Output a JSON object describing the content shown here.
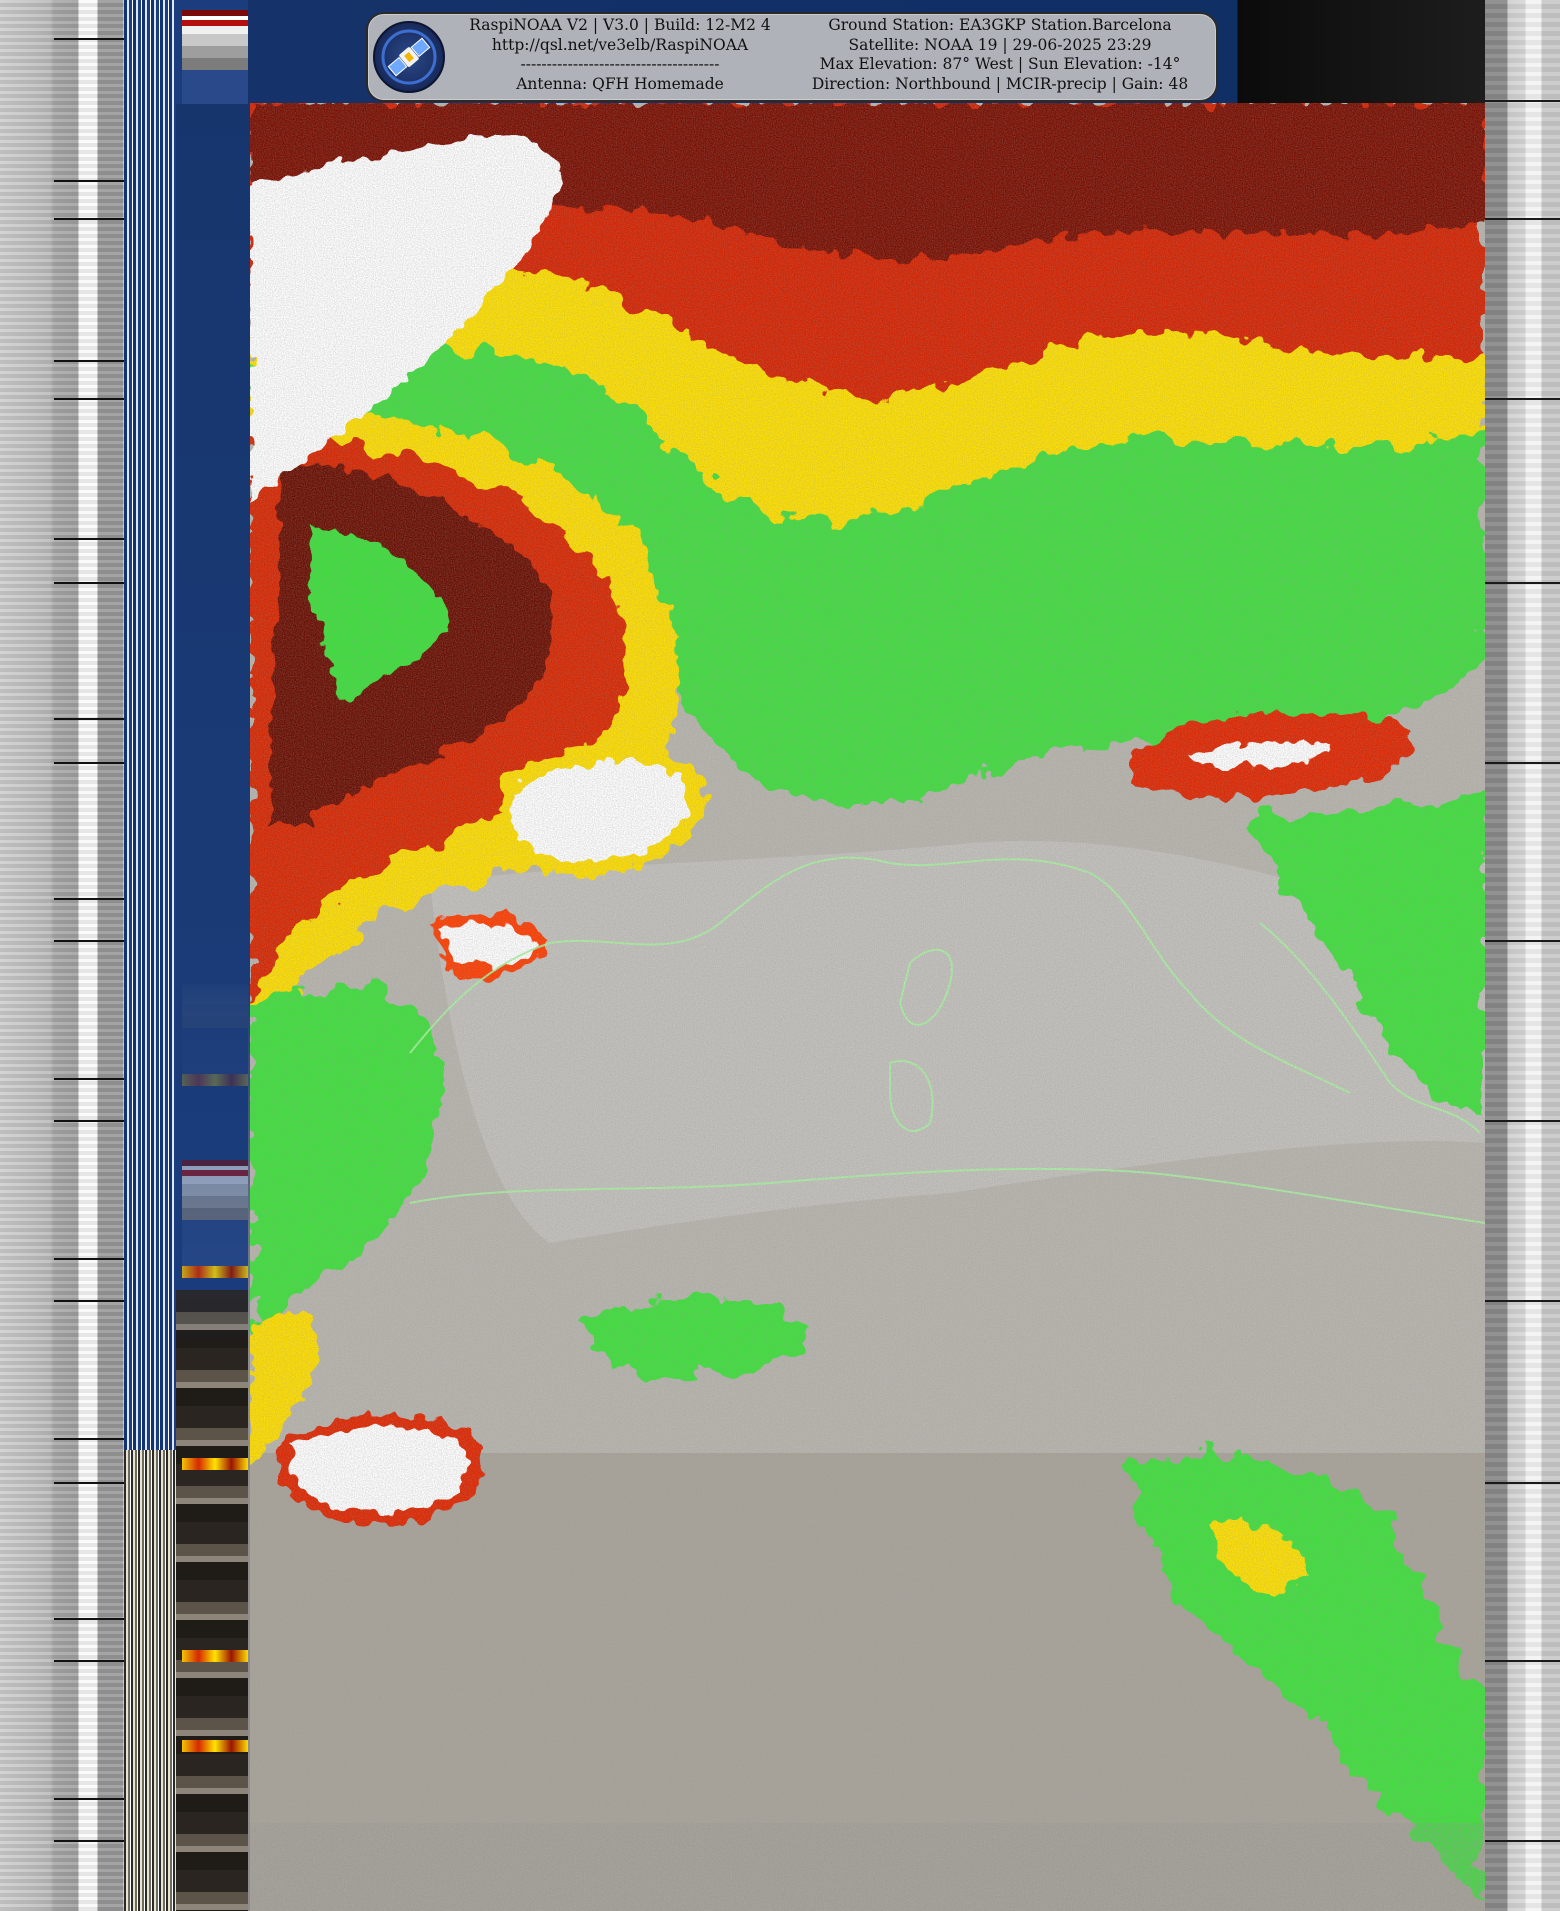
{
  "header": {
    "left_lines": [
      "RaspiNOAA V2 | V3.0 | Build: 12-M2 4",
      "http://qsl.net/ve3elb/RaspiNOAA",
      "--------------------------------------",
      "Antenna: QFH Homemade"
    ],
    "right_lines": [
      "Ground Station: EA3GKP Station.Barcelona",
      "Satellite: NOAA 19 | 29-06-2025 23:29",
      "Max Elevation: 87° West | Sun Elevation: -14°",
      "Direction: Northbound | MCIR-precip | Gain: 48"
    ],
    "logo_icon": "satellite-icon"
  },
  "image": {
    "enhancement": "MCIR-precip",
    "palette": {
      "land": "#b6b3ac",
      "ocean": "#1a3b77",
      "cloud_cold": "#ffffff",
      "precip_heavy": "#8a0a00",
      "precip_medium": "#e03000",
      "precip_light": "#ffe000",
      "cloud_low": "#3ee03e"
    }
  }
}
